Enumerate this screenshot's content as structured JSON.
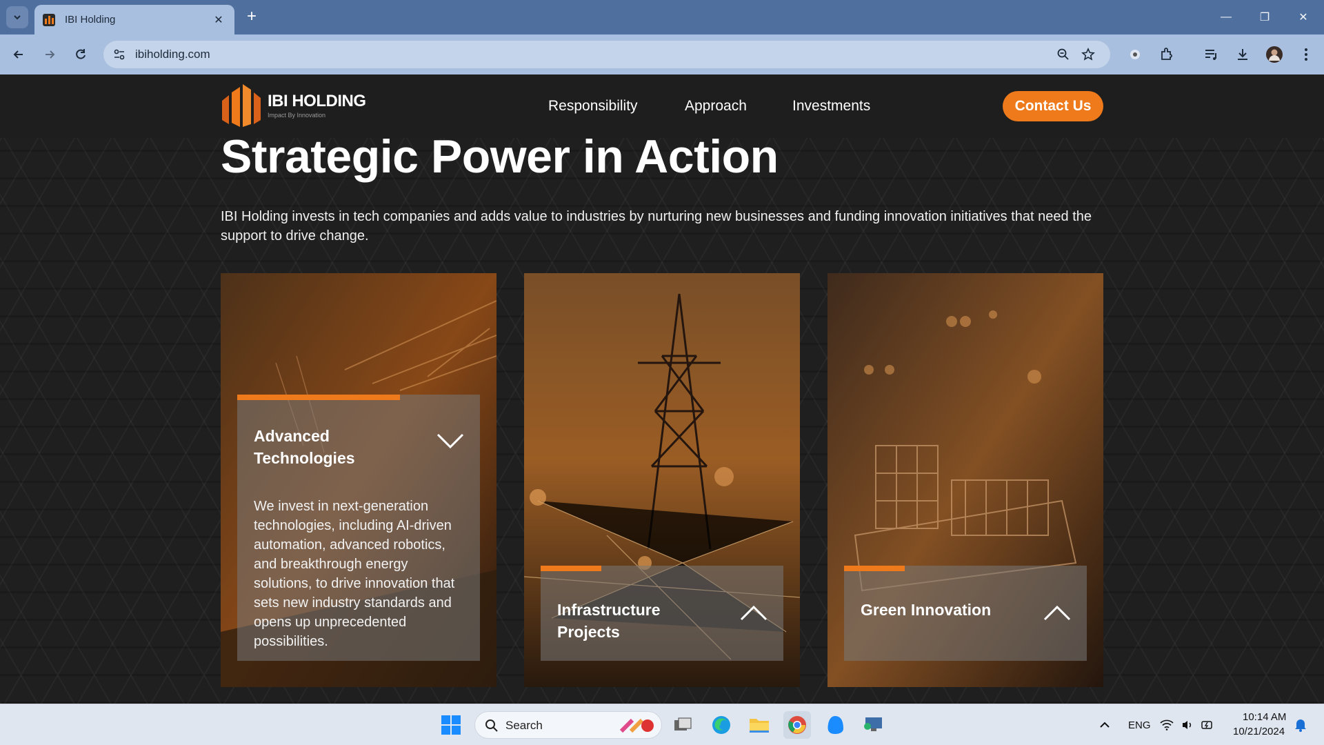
{
  "browser": {
    "tab_title": "IBI Holding",
    "new_tab_symbol": "+",
    "url": "ibiholding.com",
    "icons": [
      "tab-search-icon",
      "back-icon",
      "forward-icon",
      "reload-icon",
      "site-info-icon",
      "zoom-icon",
      "bookmark-star-icon",
      "extension-record-icon",
      "extensions-icon",
      "media-control-icon",
      "download-icon",
      "profile-avatar-icon",
      "menu-icon",
      "minimize-icon",
      "restore-icon",
      "close-icon"
    ]
  },
  "site": {
    "brand_name": "IBI HOLDING",
    "brand_tagline": "Impact By Innovation",
    "nav": [
      "Responsibility",
      "Approach",
      "Investments"
    ],
    "contact_label": "Contact Us",
    "headline": "Strategic Power in Action",
    "intro": "IBI Holding invests in tech companies and adds value to industries by nurturing new businesses and funding innovation initiatives that need the support to drive change.",
    "cards": [
      {
        "title": "Advanced Technologies",
        "expanded": true,
        "description": "We invest in next-generation technologies, including AI-driven automation, advanced robotics, and breakthrough energy solutions, to drive innovation that sets new industry standards and opens up unprecedented possibilities."
      },
      {
        "title": "Infrastructure Projects",
        "expanded": false
      },
      {
        "title": "Green Innovation",
        "expanded": false
      }
    ],
    "accent_color": "#ee7a1b"
  },
  "taskbar": {
    "search_label": "Search",
    "language": "ENG",
    "time": "10:14 AM",
    "date": "10/21/2024"
  }
}
